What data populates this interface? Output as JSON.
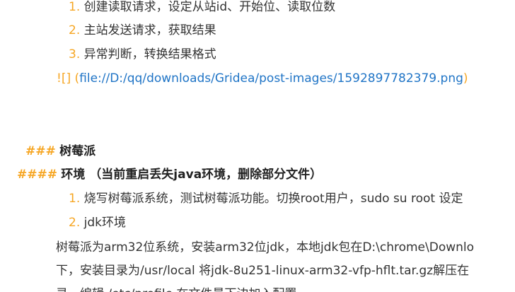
{
  "list_a": [
    {
      "num": "1.",
      "text": "创建读取请求，设定从站id、开始位、读取位数"
    },
    {
      "num": "2.",
      "text": "主站发送请求，获取结果"
    },
    {
      "num": "3.",
      "text": "异常判断，转换结果格式"
    }
  ],
  "image_link": {
    "prefix": "![]",
    "open": "(",
    "url": "file://D:/qq/downloads/Gridea/post-images/1592897782379.png",
    "close": ")"
  },
  "h3": {
    "marker": "###",
    "text": "树莓派"
  },
  "h4": {
    "marker": "####",
    "text": "环境  （当前重启丢失java环境，删除部分文件）"
  },
  "list_b": [
    {
      "num": "1.",
      "text": "烧写树莓派系统，测试树莓派功能。切换root用户，sudo su root 设定"
    },
    {
      "num": "2.",
      "text": "jdk环境"
    }
  ],
  "paragraph": {
    "line1": "树莓派为arm32位系统，安装arm32位jdk，本地jdk包在D:\\chrome\\Downlo",
    "line2": "下，安装目录为/usr/local 将jdk-8u251-linux-arm32-vfp-hflt.tar.gz解压在",
    "line3": "录，编辑 /etc/profile 在文件最下边加入配置"
  }
}
